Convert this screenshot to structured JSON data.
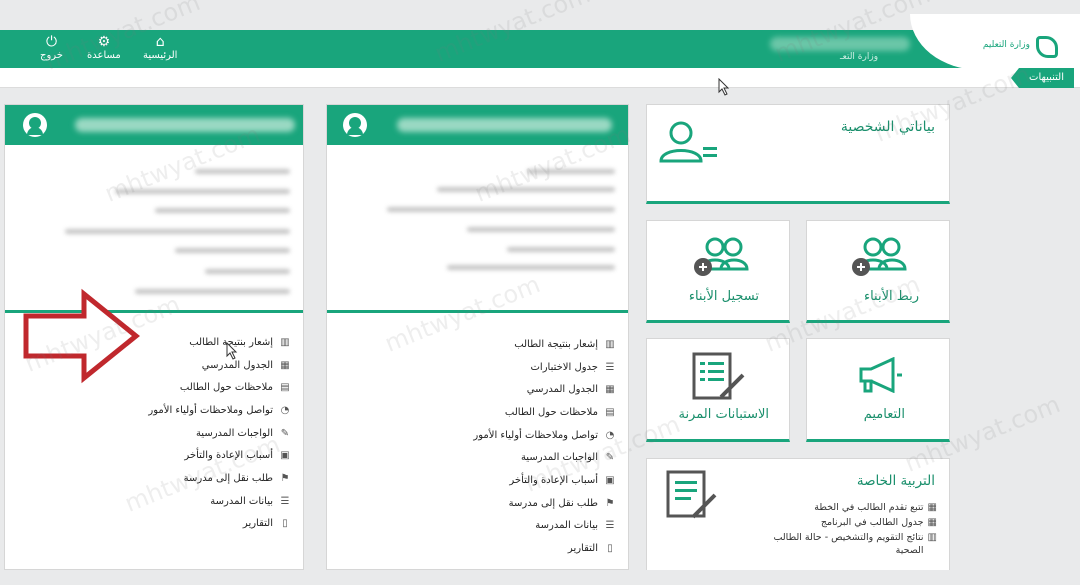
{
  "header": {
    "logo_text": "وزارة التعليم",
    "user_name": "وزارة التعـ",
    "nav": [
      {
        "label": "الرئيسية",
        "icon": "home-icon"
      },
      {
        "label": "مساعدة",
        "icon": "gear-icon"
      },
      {
        "label": "خروج",
        "icon": "power-icon"
      }
    ]
  },
  "notices": {
    "label": "التنبيهات"
  },
  "student_card_left": {
    "menu": [
      {
        "label": "إشعار بنتيجة الطالب",
        "icon": "chart-icon"
      },
      {
        "label": "الجدول المدرسي",
        "icon": "calendar-icon"
      },
      {
        "label": "ملاحظات حول الطالب",
        "icon": "notes-icon"
      },
      {
        "label": "تواصل وملاحظات أولياء الأمور",
        "icon": "chat-icon"
      },
      {
        "label": "الواجبات المدرسية",
        "icon": "edit-icon"
      },
      {
        "label": "أسباب الإعادة والتأخر",
        "icon": "book-icon"
      },
      {
        "label": "طلب نقل إلى مدرسة",
        "icon": "flag-icon"
      },
      {
        "label": "بيانات المدرسة",
        "icon": "list-icon"
      },
      {
        "label": "التقارير",
        "icon": "file-icon"
      }
    ]
  },
  "student_card_middle": {
    "menu": [
      {
        "label": "إشعار بنتيجة الطالب",
        "icon": "chart-icon"
      },
      {
        "label": "جدول الاختبارات",
        "icon": "list-icon"
      },
      {
        "label": "الجدول المدرسي",
        "icon": "calendar-icon"
      },
      {
        "label": "ملاحظات حول الطالب",
        "icon": "notes-icon"
      },
      {
        "label": "تواصل وملاحظات أولياء الأمور",
        "icon": "chat-icon"
      },
      {
        "label": "الواجبات المدرسية",
        "icon": "edit-icon"
      },
      {
        "label": "أسباب الإعادة والتأخر",
        "icon": "book-icon"
      },
      {
        "label": "طلب نقل إلى مدرسة",
        "icon": "flag-icon"
      },
      {
        "label": "بيانات المدرسة",
        "icon": "list-icon"
      },
      {
        "label": "التقارير",
        "icon": "file-icon"
      }
    ]
  },
  "tiles": {
    "personal": "بياناتي الشخصية",
    "link_children": "ربط الأبناء",
    "register_children": "تسجيل الأبناء",
    "circulars": "التعاميم",
    "surveys": "الاستبانات المرنة",
    "special_ed": {
      "title": "التربية الخاصة",
      "items": [
        "تتبع تقدم الطالب في الخطة",
        "جدول الطالب في البرنامج",
        "نتائج التقويم والتشخيص - حالة الطالب الصحية"
      ]
    }
  },
  "watermark": "mhtwyat.com",
  "colors": {
    "accent": "#19a57c",
    "arrow": "#c0282d"
  }
}
